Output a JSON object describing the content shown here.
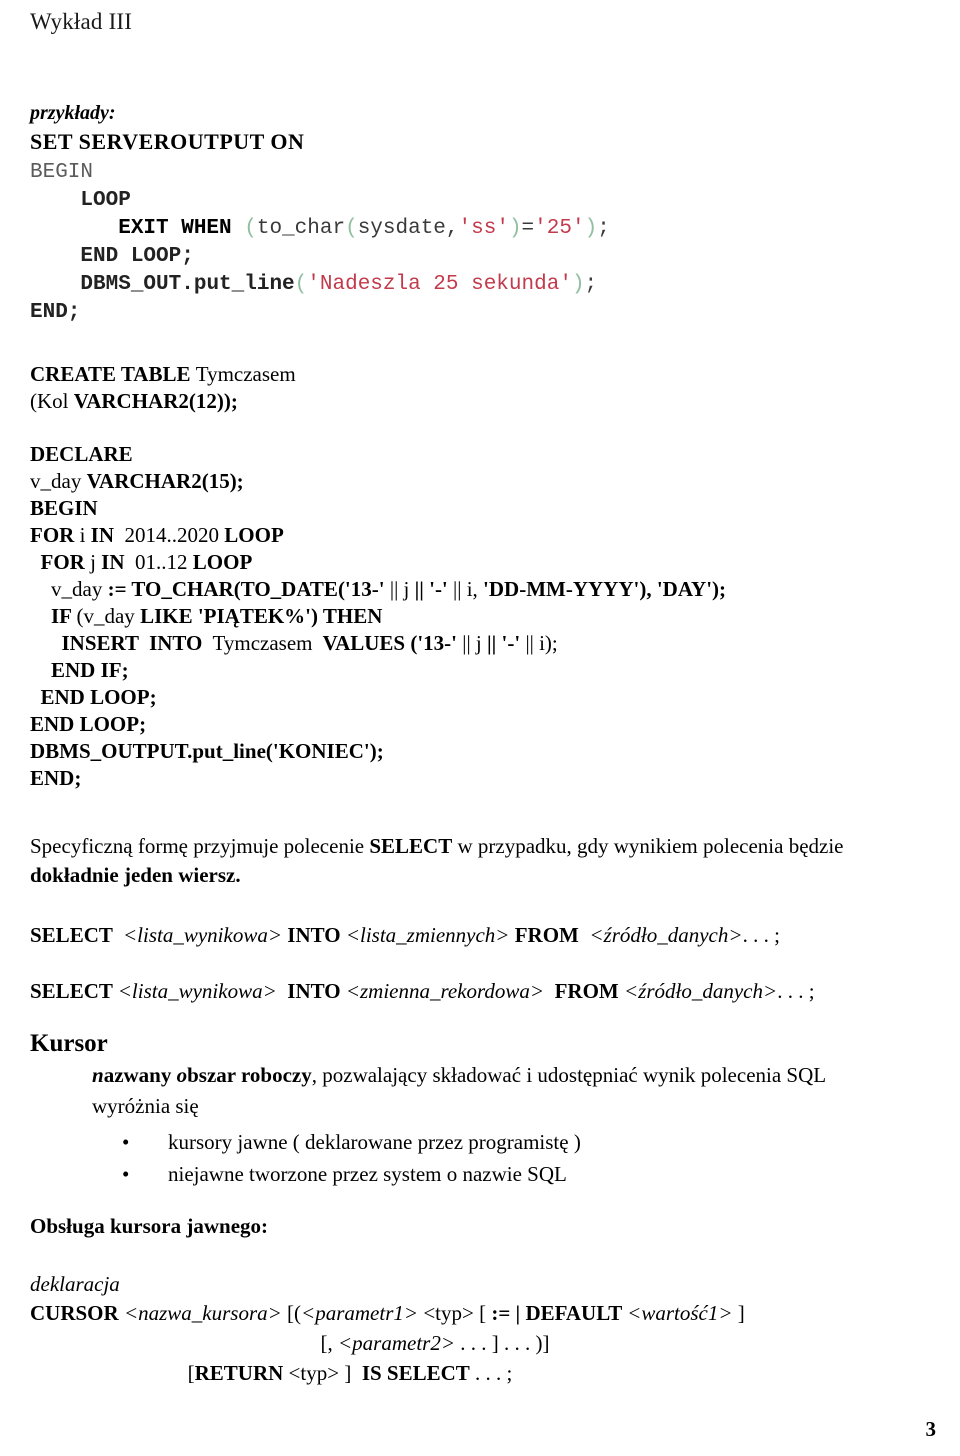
{
  "document": {
    "header": "Wykład III",
    "page_number": "3"
  },
  "labels": {
    "przyklady": "przykłady:",
    "deklaracja": "deklaracja",
    "obsluga_kursora": "Obsługa kursora jawnego:",
    "kursor_heading": "Kursor"
  },
  "code_block_1": {
    "lines": [
      {
        "id": "set-serveroutput",
        "tokens": [
          {
            "text": "SET SERVEROUTPUT ON",
            "style": "serif-bold"
          }
        ]
      },
      {
        "id": "begin",
        "tokens": [
          {
            "text": "BEGIN",
            "style": "dim"
          }
        ]
      },
      {
        "id": "loop",
        "tokens": [
          {
            "text": "    ",
            "style": "plain"
          },
          {
            "text": "LOOP",
            "style": "dark"
          }
        ]
      },
      {
        "id": "exit-when",
        "tokens": [
          {
            "text": "       ",
            "style": "plain"
          },
          {
            "text": "EXIT WHEN ",
            "style": "bold"
          },
          {
            "text": "(",
            "style": "paren"
          },
          {
            "text": "to_char",
            "style": "plain"
          },
          {
            "text": "(",
            "style": "paren"
          },
          {
            "text": "sysdate,",
            "style": "plain"
          },
          {
            "text": "'ss'",
            "style": "str"
          },
          {
            "text": ")",
            "style": "paren"
          },
          {
            "text": "=",
            "style": "plain"
          },
          {
            "text": "'25'",
            "style": "str"
          },
          {
            "text": ")",
            "style": "paren"
          },
          {
            "text": ";",
            "style": "plain"
          }
        ]
      },
      {
        "id": "end-loop",
        "tokens": [
          {
            "text": "    ",
            "style": "plain"
          },
          {
            "text": "END LOOP;",
            "style": "dark"
          }
        ]
      },
      {
        "id": "dbms-out-put-line",
        "tokens": [
          {
            "text": "    ",
            "style": "plain"
          },
          {
            "text": "DBMS_OUT.put_line",
            "style": "dark"
          },
          {
            "text": "(",
            "style": "paren"
          },
          {
            "text": "'Nadeszla 25 sekunda'",
            "style": "str"
          },
          {
            "text": ")",
            "style": "paren"
          },
          {
            "text": ";",
            "style": "plain"
          }
        ]
      },
      {
        "id": "end",
        "tokens": [
          {
            "text": "END;",
            "style": "dark"
          }
        ]
      }
    ]
  },
  "code_block_2": {
    "lines": [
      {
        "id": "create-table",
        "tokens": [
          {
            "text": "CREATE TABLE ",
            "bold": true
          },
          {
            "text": "Tymczasem",
            "bold": false
          }
        ]
      },
      {
        "id": "kol-varchar",
        "tokens": [
          {
            "text": "(Kol ",
            "bold": false
          },
          {
            "text": "VARCHAR2(12));",
            "bold": true
          }
        ]
      }
    ]
  },
  "code_block_3": {
    "lines": [
      {
        "id": "declare",
        "tokens": [
          {
            "text": "DECLARE",
            "bold": true
          }
        ]
      },
      {
        "id": "v-day-decl",
        "tokens": [
          {
            "text": "v_day ",
            "bold": false
          },
          {
            "text": "VARCHAR2(15);",
            "bold": true
          }
        ]
      },
      {
        "id": "begin-2",
        "tokens": [
          {
            "text": "BEGIN",
            "bold": true
          }
        ]
      },
      {
        "id": "for-i",
        "tokens": [
          {
            "text": "FOR ",
            "bold": true
          },
          {
            "text": "i ",
            "bold": false
          },
          {
            "text": "IN ",
            "bold": true
          },
          {
            "text": " 2014..2020 ",
            "bold": false
          },
          {
            "text": "LOOP",
            "bold": true
          }
        ]
      },
      {
        "id": "for-j",
        "tokens": [
          {
            "text": "  FOR ",
            "bold": true
          },
          {
            "text": "j ",
            "bold": false
          },
          {
            "text": "IN ",
            "bold": true
          },
          {
            "text": " 01..12 ",
            "bold": false
          },
          {
            "text": "LOOP",
            "bold": true
          }
        ]
      },
      {
        "id": "v-day-assign",
        "tokens": [
          {
            "text": "    v_day ",
            "bold": false
          },
          {
            "text": ":= TO_CHAR(TO_DATE('13-' ",
            "bold": true
          },
          {
            "text": "|| j ",
            "bold": false
          },
          {
            "text": "|| '-' ",
            "bold": true
          },
          {
            "text": "|| i, ",
            "bold": false
          },
          {
            "text": "'DD-MM-YYYY'), 'DAY');",
            "bold": true
          }
        ]
      },
      {
        "id": "if-like",
        "tokens": [
          {
            "text": "    IF ",
            "bold": true
          },
          {
            "text": "(v_day ",
            "bold": false
          },
          {
            "text": "LIKE 'PIĄTEK%') THEN",
            "bold": true
          }
        ]
      },
      {
        "id": "insert-into",
        "tokens": [
          {
            "text": "      INSERT  INTO ",
            "bold": true
          },
          {
            "text": " Tymczasem ",
            "bold": false
          },
          {
            "text": " VALUES ('13-' ",
            "bold": true
          },
          {
            "text": "|| j ",
            "bold": false
          },
          {
            "text": "|| '-' ",
            "bold": true
          },
          {
            "text": "|| i);",
            "bold": false
          }
        ]
      },
      {
        "id": "end-if",
        "tokens": [
          {
            "text": "    END IF;",
            "bold": true
          }
        ]
      },
      {
        "id": "end-loop-inner",
        "tokens": [
          {
            "text": "  END LOOP;",
            "bold": true
          }
        ]
      },
      {
        "id": "end-loop-outer",
        "tokens": [
          {
            "text": "END LOOP;",
            "bold": true
          }
        ]
      },
      {
        "id": "dbms-output-koniec",
        "tokens": [
          {
            "text": "DBMS_OUTPUT.put_line('KONIEC');",
            "bold": true
          }
        ]
      },
      {
        "id": "end-2",
        "tokens": [
          {
            "text": "END;",
            "bold": true
          }
        ]
      }
    ]
  },
  "paragraph_select": {
    "segments": [
      {
        "text": "Specyficzną formę przyjmuje polecenie ",
        "bold": false
      },
      {
        "text": "SELECT",
        "bold": true
      },
      {
        "text": " w przypadku, gdy wynikiem polecenia będzie ",
        "bold": false
      }
    ],
    "line2": "dokładnie jeden wiersz."
  },
  "select_syntax_1": {
    "segments": [
      {
        "text": "SELECT  ",
        "bold": true,
        "italic": false
      },
      {
        "text": "<lista_wynikowa>",
        "bold": false,
        "italic": true
      },
      {
        "text": " INTO ",
        "bold": true,
        "italic": false
      },
      {
        "text": "<lista_zmiennych>",
        "bold": false,
        "italic": true
      },
      {
        "text": " FROM  ",
        "bold": true,
        "italic": false
      },
      {
        "text": "<źródło_danych>",
        "bold": false,
        "italic": true
      },
      {
        "text": ". . . ;",
        "bold": false,
        "italic": false
      }
    ]
  },
  "select_syntax_2": {
    "segments": [
      {
        "text": "SELECT ",
        "bold": true,
        "italic": false
      },
      {
        "text": "<lista_wynikowa>",
        "bold": false,
        "italic": true
      },
      {
        "text": "  INTO ",
        "bold": true,
        "italic": false
      },
      {
        "text": "<zmienna_rekordowa>",
        "bold": false,
        "italic": true
      },
      {
        "text": "  FROM ",
        "bold": true,
        "italic": false
      },
      {
        "text": "<źródło_danych>",
        "bold": false,
        "italic": true
      },
      {
        "text": ". . . ;",
        "bold": false,
        "italic": false
      }
    ]
  },
  "kursor": {
    "definition_segments": [
      {
        "text": "n",
        "bold": true,
        "italic": true
      },
      {
        "text": "azwany ",
        "bold": true,
        "italic": false
      },
      {
        "text": "o",
        "bold": true,
        "italic": true
      },
      {
        "text": "bszar roboczy",
        "bold": true,
        "italic": false
      },
      {
        "text": ", pozwalający składować i udostępniać wynik polecenia SQL",
        "bold": false,
        "italic": false
      }
    ],
    "definition_line2": "wyróżnia się",
    "bullet_marker": "•",
    "bullets": [
      "kursory jawne ( deklarowane przez programistę )",
      "niejawne tworzone przez system o nazwie SQL"
    ]
  },
  "cursor_declaration": {
    "line1_segments": [
      {
        "text": "CURSOR ",
        "bold": true,
        "italic": false
      },
      {
        "text": "<nazwa_kursora>",
        "bold": false,
        "italic": true
      },
      {
        "text": " [(",
        "bold": false,
        "italic": false
      },
      {
        "text": "<parametr1>",
        "bold": false,
        "italic": true
      },
      {
        "text": " <typ>",
        "bold": false,
        "italic": false
      },
      {
        "text": " [ ",
        "bold": false,
        "italic": false
      },
      {
        "text": ":= |",
        "bold": true,
        "italic": false
      },
      {
        "text": " DEFAULT ",
        "bold": true,
        "italic": false
      },
      {
        "text": "<wartość1>",
        "bold": false,
        "italic": true
      },
      {
        "text": " ]",
        "bold": false,
        "italic": false
      }
    ],
    "line2_segments": [
      {
        "text": "[, ",
        "bold": false,
        "italic": false
      },
      {
        "text": "<parametr2>",
        "bold": false,
        "italic": true
      },
      {
        "text": " . . . ] . . . )]",
        "bold": false,
        "italic": false
      }
    ],
    "line3_segments": [
      {
        "text": "[",
        "bold": false,
        "italic": false
      },
      {
        "text": "RETURN ",
        "bold": true,
        "italic": false
      },
      {
        "text": "<typ>",
        "bold": false,
        "italic": false
      },
      {
        "text": " ]  ",
        "bold": false,
        "italic": false
      },
      {
        "text": "IS SELECT",
        "bold": true,
        "italic": false
      },
      {
        "text": " . . . ;",
        "bold": false,
        "italic": false
      }
    ]
  }
}
